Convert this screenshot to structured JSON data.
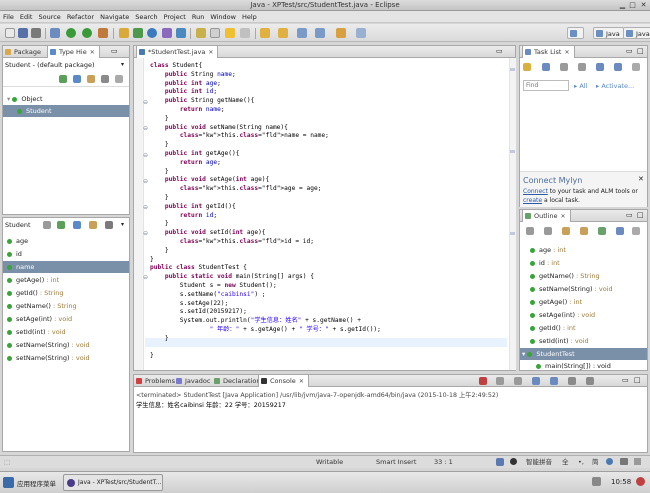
{
  "window": {
    "title": "Java - XPTest/src/StudentTest.java - Eclipse"
  },
  "menu": [
    "File",
    "Edit",
    "Source",
    "Refactor",
    "Navigate",
    "Search",
    "Project",
    "Run",
    "Window",
    "Help"
  ],
  "perspectives": [
    "Java",
    "Java"
  ],
  "left_panel": {
    "tabs": [
      "Package",
      "Type Hie"
    ],
    "header": "Student - (default package)",
    "tree": [
      "Object",
      "Student"
    ],
    "members_header": "Student",
    "members": [
      {
        "name": "age",
        "type": ""
      },
      {
        "name": "id",
        "type": ""
      },
      {
        "name": "name",
        "type": ""
      },
      {
        "name": "getAge()",
        "type": " : int"
      },
      {
        "name": "getId()",
        "type": " : String"
      },
      {
        "name": "getName()",
        "type": " : String"
      },
      {
        "name": "setAge(int)",
        "type": " : void"
      },
      {
        "name": "setId(int)",
        "type": " : void"
      },
      {
        "name": "setName(String)",
        "type": " : void"
      },
      {
        "name": "setName(String)",
        "type": " : void"
      }
    ]
  },
  "editor": {
    "tab": "*StudentTest.java",
    "lines": [
      "class Student{",
      "    public String name;",
      "    public int age;",
      "    public int id;",
      "    public String getName(){",
      "        return name;",
      "    }",
      "    public void setName(String name){",
      "        this.name = name;",
      "    }",
      "    public int getAge(){",
      "        return age;",
      "    }",
      "    public void setAge(int age){",
      "        this.age = age;",
      "    }",
      "    public int getId(){",
      "        return id;",
      "    }",
      "    public void setId(int age){",
      "        this.id = id;",
      "    }",
      "}",
      "public class StudentTest {",
      "    public static void main(String[] args) {",
      "        Student s = new Student();",
      "        s.setName(\"caibinsi\") ;",
      "        s.setAge(22);",
      "        s.setId(20159217);",
      "        System.out.println(\"学生信息：姓名\" + s.getName() +",
      "                \" 年龄：\" + s.getAge() + \" 学号：\" + s.getId());",
      "    }",
      "",
      "}"
    ]
  },
  "task_list": {
    "tab": "Task List",
    "find_placeholder": "Find",
    "all_label": "All",
    "activate_label": "Activate..."
  },
  "mylyn": {
    "title": "Connect Mylyn",
    "line1_link": "Connect",
    "line1_rest": " to your task and ALM tools or",
    "line2_link": "create",
    "line2_rest": " a local task."
  },
  "outline": {
    "tab": "Outline",
    "items": [
      {
        "name": "age",
        "type": " : int"
      },
      {
        "name": "id",
        "type": " : int"
      },
      {
        "name": "getName()",
        "type": " : String"
      },
      {
        "name": "setName(String)",
        "type": " : void"
      },
      {
        "name": "getAge()",
        "type": " : int"
      },
      {
        "name": "setAge(int)",
        "type": " : void"
      },
      {
        "name": "getId()",
        "type": " : int"
      },
      {
        "name": "setId(int)",
        "type": " : void"
      }
    ],
    "class2": "StudentTest",
    "main": "main(String[]) : void"
  },
  "bottom": {
    "tabs": [
      "Problems",
      "Javadoc",
      "Declaration",
      "Console"
    ],
    "console_header": "<terminated> StudentTest [Java Application] /usr/lib/jvm/java-7-openjdk-amd64/bin/java (2015-10-18 上午2:49:52)",
    "console_output": "学生信息：姓名caibinsi 年龄：22 学号：20159217"
  },
  "status": {
    "writable": "Writable",
    "insert": "Smart Insert",
    "position": "33 : 1",
    "ime": "智能拼音",
    "ime_full": "全",
    "ime_width": "简"
  },
  "taskbar": {
    "start": "应用程序菜单",
    "task": "Java - XPTest/src/StudentT...",
    "clock": "10:58"
  },
  "colors": {
    "keyword": "#7f0055",
    "field": "#0000c0",
    "string": "#2a00ff",
    "accent": "#5b8ac7"
  }
}
